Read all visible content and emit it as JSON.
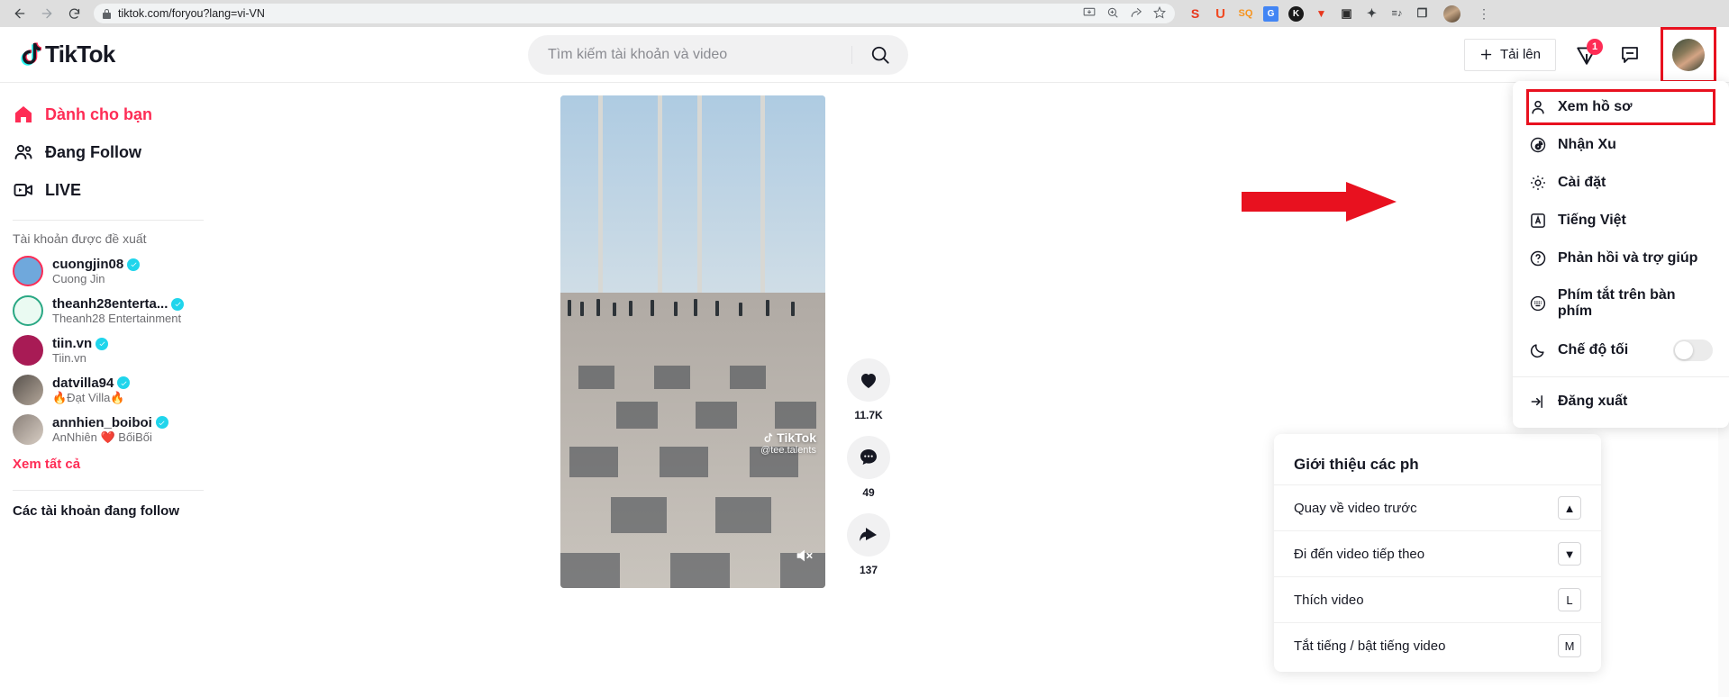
{
  "browser": {
    "url": "tiktok.com/foryou?lang=vi-VN",
    "back_icon": "←",
    "forward_icon": "→",
    "reload_icon": "⟳",
    "lock_icon": "lock-icon",
    "omni_icons": [
      "install-icon",
      "zoom-icon",
      "share-icon",
      "bookmark-star-icon"
    ],
    "extensions": [
      {
        "name": "seoquake-extension",
        "glyph": "S",
        "color": "#e8361c"
      },
      {
        "name": "ublock-extension",
        "glyph": "U",
        "color": "#f04a23"
      },
      {
        "name": "seo-minion-extension",
        "glyph": "SQ",
        "color": "#f7941e"
      },
      {
        "name": "google-translate-extension",
        "glyph": "G",
        "color": "#4285f4"
      },
      {
        "name": "kiwi-extension",
        "glyph": "K",
        "color": "#1a1a1a"
      },
      {
        "name": "vidiq-extension",
        "glyph": "▼",
        "color": "#e8361c"
      },
      {
        "name": "screen-capture-extension",
        "glyph": "▣",
        "color": "#2b2b2b"
      },
      {
        "name": "puzzle-extension",
        "glyph": "✦",
        "color": "#3c4043"
      },
      {
        "name": "playlist-extension",
        "glyph": "≡♪",
        "color": "#3c4043"
      },
      {
        "name": "reading-mode-extension",
        "glyph": "❐",
        "color": "#3c4043"
      }
    ],
    "kebab_icon": "⋮"
  },
  "header": {
    "logo_text": "TikTok",
    "search_placeholder": "Tìm kiếm tài khoản và video",
    "search_value": "",
    "upload_label": "Tải lên",
    "upload_plus": "+",
    "inbox_badge": "1",
    "inbox_icon": "paper-plane-icon",
    "message_icon": "message-icon",
    "avatar_name": "profile-avatar"
  },
  "sidebar": {
    "nav": [
      {
        "label": "Dành cho bạn",
        "icon": "home-icon",
        "active": true
      },
      {
        "label": "Đang Follow",
        "icon": "people-icon",
        "active": false
      },
      {
        "label": "LIVE",
        "icon": "live-video-icon",
        "active": false
      }
    ],
    "suggested_title": "Tài khoản được đề xuất",
    "accounts": [
      {
        "handle": "cuongjin08",
        "display": "Cuong Jin",
        "verified": true,
        "ring": "#fe2c55",
        "avatar_color": "#6fa8dc"
      },
      {
        "handle": "theanh28enterta...",
        "display": "Theanh28 Entertainment",
        "verified": true,
        "ring": "#2aa884",
        "avatar_color": "#eafaf2"
      },
      {
        "handle": "tiin.vn",
        "display": "Tiin.vn",
        "verified": true,
        "ring": "#a81b55",
        "avatar_color": "#a81b55"
      },
      {
        "handle": "datvilla94",
        "display": "🔥Đạt Villa🔥",
        "verified": true,
        "ring": "#444",
        "avatar_color": "#57514c"
      },
      {
        "handle": "annhien_boiboi",
        "display": "AnNhiên ❤️ BốiBối",
        "verified": true,
        "ring": "#555",
        "avatar_color": "#8a8079"
      }
    ],
    "see_all": "Xem tất cả",
    "following_title": "Các tài khoản đang follow"
  },
  "video": {
    "watermark_main": "TikTok",
    "watermark_sub": "@tee.talents",
    "mute_icon": "speaker-mute-icon",
    "actions": [
      {
        "icon": "heart-icon",
        "count": "11.7K",
        "name": "like-button"
      },
      {
        "icon": "comment-icon",
        "count": "49",
        "name": "comment-button"
      },
      {
        "icon": "share-icon",
        "count": "137",
        "name": "share-button"
      }
    ]
  },
  "dropdown": {
    "items": [
      {
        "label": "Xem hồ sơ",
        "icon": "person-icon",
        "highlighted": true,
        "name": "menu-view-profile"
      },
      {
        "label": "Nhận Xu",
        "icon": "coin-icon",
        "highlighted": false,
        "name": "menu-get-coins"
      },
      {
        "label": "Cài đặt",
        "icon": "gear-icon",
        "highlighted": false,
        "name": "menu-settings"
      },
      {
        "label": "Tiếng Việt",
        "icon": "language-icon",
        "highlighted": false,
        "name": "menu-language"
      },
      {
        "label": "Phản hồi và trợ giúp",
        "icon": "question-icon",
        "highlighted": false,
        "name": "menu-feedback-help"
      },
      {
        "label": "Phím tắt trên bàn phím",
        "icon": "keyboard-icon",
        "highlighted": false,
        "name": "menu-keyboard-shortcuts"
      },
      {
        "label": "Chế độ tối",
        "icon": "moon-icon",
        "highlighted": false,
        "toggle": true,
        "toggle_on": false,
        "name": "menu-dark-mode"
      },
      {
        "label": "Đăng xuất",
        "icon": "logout-icon",
        "highlighted": false,
        "separator_before": true,
        "name": "menu-logout"
      }
    ]
  },
  "shortcuts_panel": {
    "title": "Giới thiệu các ph",
    "rows": [
      {
        "label": "Quay về video trước",
        "key": "▲",
        "name": "shortcut-previous-video"
      },
      {
        "label": "Đi đến video tiếp theo",
        "key": "▼",
        "name": "shortcut-next-video"
      },
      {
        "label": "Thích video",
        "key": "L",
        "name": "shortcut-like-video"
      },
      {
        "label": "Tắt tiếng / bật tiếng video",
        "key": "M",
        "name": "shortcut-mute-video"
      }
    ]
  },
  "annotation": {
    "arrow_color": "#e8111f",
    "highlight_color": "#e8111f"
  }
}
